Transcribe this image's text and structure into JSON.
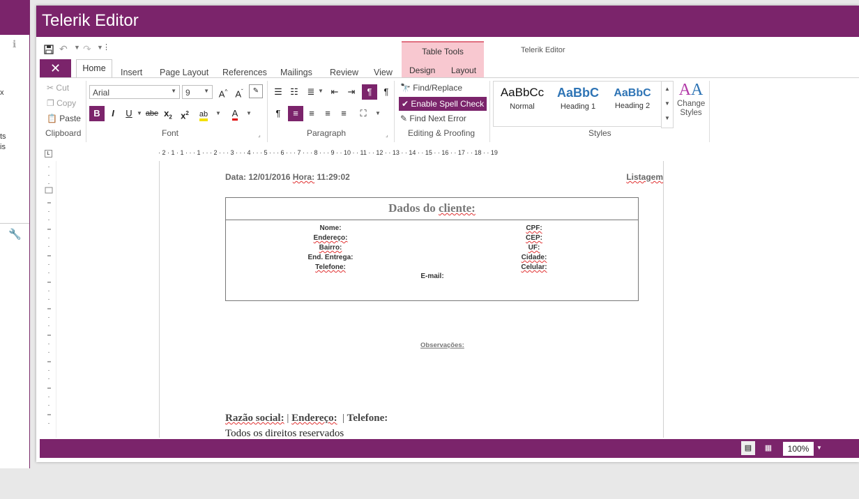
{
  "background": {
    "texts": [
      "x",
      "ts",
      "is"
    ]
  },
  "app": {
    "title": "Telerik Editor",
    "context_title": "Telerik Editor"
  },
  "ribbon": {
    "tabs": [
      "Home",
      "Insert",
      "Page Layout",
      "References",
      "Mailings",
      "Review",
      "View"
    ],
    "table_tools": {
      "label": "Table Tools",
      "tabs": [
        "Design",
        "Layout"
      ]
    },
    "clipboard": {
      "cut": "Cut",
      "copy": "Copy",
      "paste": "Paste",
      "label": "Clipboard"
    },
    "font": {
      "family": "Arial",
      "size": "9",
      "label": "Font",
      "strike": "abe"
    },
    "paragraph": {
      "label": "Paragraph"
    },
    "editing": {
      "find_replace": "Find/Replace",
      "spell_check": "Enable Spell Check",
      "find_next_error": "Find Next Error",
      "label": "Editing & Proofing"
    },
    "styles": {
      "label": "Styles",
      "items": [
        {
          "preview": "AaBbCc",
          "name": "Normal"
        },
        {
          "preview": "AaBbC",
          "name": "Heading 1"
        },
        {
          "preview": "AaBbC",
          "name": "Heading 2"
        }
      ],
      "change_styles": "Change Styles"
    },
    "accent_color": "#7b246b"
  },
  "ruler": {
    "text": "· 2 · 1 · 1 · · · 1 · · · 2 · · · 3 · · · 4 · · · 5 · · · 6 · · · 7 · · · 8 · · · 9 · · 10 · · 11 · · 12 · · 13 · · 14 · · 15 · · 16 · · 17 · · 18 · · 19"
  },
  "document": {
    "header": {
      "data_label": "Data:",
      "date": "12/01/2016",
      "hora_label": "Hora:",
      "time": "11:29:02",
      "listagem": "Listagem"
    },
    "table_title_a": "Dados do ",
    "table_title_b": "cliente:",
    "fields_left": [
      "Nome:",
      "Endereço:",
      "Bairro:",
      "End. Entrega:",
      "Telefone:"
    ],
    "fields_right": [
      "CPF:",
      "CEP:",
      "UF:",
      "Cidade:",
      "Celular:"
    ],
    "email": "E-mail:",
    "observacoes": "Observações:",
    "footer_line1": {
      "razao": "Razão social:",
      "sep1": "|",
      "endereco": "Endereço:",
      "sep2": "|",
      "telefone": "Telefone:"
    },
    "footer_line2": "Todos os direitos reservados"
  },
  "status": {
    "zoom": "100%"
  }
}
